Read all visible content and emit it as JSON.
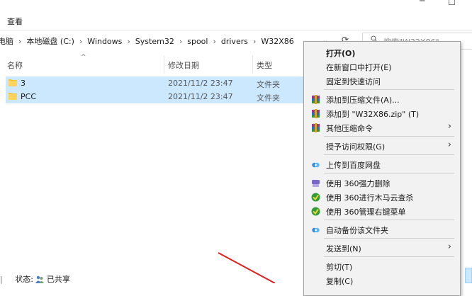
{
  "ribbon": {
    "tab_view": "查看"
  },
  "address": {
    "crumbs": [
      "电脑",
      "本地磁盘 (C:)",
      "Windows",
      "System32",
      "spool",
      "drivers",
      "W32X86"
    ]
  },
  "search": {
    "placeholder": "搜索\"W32X86\""
  },
  "columns": {
    "name": "名称",
    "modified": "修改日期",
    "type": "类型"
  },
  "files": [
    {
      "name": "3",
      "modified": "2021/11/2 23:47",
      "type": "文件夹"
    },
    {
      "name": "PCC",
      "modified": "2021/11/2 23:47",
      "type": "文件夹"
    }
  ],
  "status": {
    "prefix": "状态:",
    "shared": "已共享"
  },
  "menu": {
    "open": "打开(O)",
    "open_new_window": "在新窗口中打开(E)",
    "pin_quick": "固定到快速访问",
    "add_archive": "添加到压缩文件(A)...",
    "add_zip": "添加到 \"W32X86.zip\" (T)",
    "other_compress": "其他压缩命令",
    "grant_access": "授予访问权限(G)",
    "upload_baidu": "上传到百度网盘",
    "force_delete_360": "使用 360强力删除",
    "scan_360": "使用 360进行木马云查杀",
    "manage_360": "使用 360管理右键菜单",
    "auto_backup": "自动备份该文件夹",
    "send_to": "发送到(N)",
    "cut": "剪切(T)",
    "copy": "复制(C)"
  },
  "colors": {
    "selection": "#cce8ff",
    "folder": "#f5c33b",
    "red_arrow": "#e02020"
  }
}
